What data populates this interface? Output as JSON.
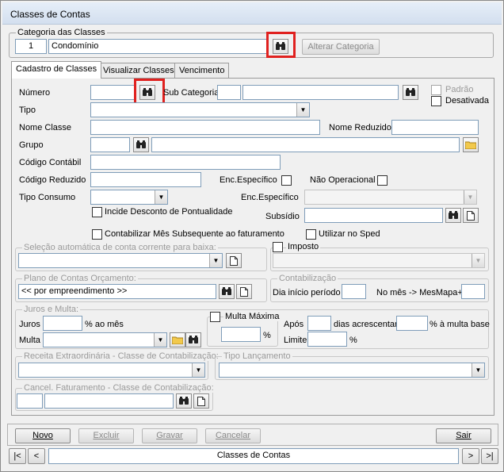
{
  "window": {
    "title": "Classes de Contas"
  },
  "categoria": {
    "caption": "Categoria das Classes",
    "code": "1",
    "name": "Condomínio",
    "alter_button": "Alterar Categoria"
  },
  "tabs": [
    {
      "label": "Cadastro de Classes",
      "active": true
    },
    {
      "label": "Visualizar Classes",
      "active": false
    },
    {
      "label": "Vencimento",
      "active": false
    }
  ],
  "form": {
    "numero_label": "Número",
    "numero_value": "",
    "subcategoria_label": "Sub Categoria",
    "padrao_label": "Padrão",
    "desativada_label": "Desativada",
    "tipo_label": "Tipo",
    "nome_classe_label": "Nome Classe",
    "nome_reduzido_label": "Nome Reduzido",
    "grupo_label": "Grupo",
    "codigo_contabil_label": "Código Contábil",
    "codigo_reduzido_label": "Código Reduzido",
    "enc_especifico_label": "Enc.Específico",
    "nao_operacional_label": "Não Operacional",
    "tipo_consumo_label": "Tipo Consumo",
    "enc_especifico2_label": "Enc.Específico",
    "incide_desconto_label": "Incide Desconto de Pontualidade",
    "subsidio_label": "Subsídio",
    "contabilizar_label": "Contabilizar Mês Subsequente ao faturamento",
    "utilizar_sped_label": "Utilizar no Sped"
  },
  "selecao": {
    "caption": "Seleção automática de conta corrente para baixa:"
  },
  "imposto": {
    "caption": "Imposto"
  },
  "plano": {
    "caption": "Plano de Contas Orçamento:",
    "value": "<< por empreendimento >>"
  },
  "contabilizacao": {
    "caption": "Contabilização",
    "dia_inicio_label": "Dia início período",
    "mes_label": "No mês -> MesMapa+"
  },
  "juros": {
    "caption": "Juros e Multa:",
    "juros_label": "Juros",
    "ao_mes_label": "% ao mês",
    "multa_label": "Multa",
    "multa_maxima_label": "Multa Máxima",
    "pct_label": "%",
    "apos_label": "Após",
    "dias_acrescentar_label": "dias acrescentar",
    "pct_multa_base_label": "% à multa base",
    "limite_label": "Limite",
    "limite_pct_label": "%"
  },
  "receita": {
    "caption": "Receita Extraordinária - Classe de Contabilização:"
  },
  "tipo_lancamento": {
    "caption": "Tipo Lançamento"
  },
  "cancel": {
    "caption": "Cancel. Faturamento - Classe de Contabilização:"
  },
  "actions": {
    "novo": "Novo",
    "excluir": "Excluir",
    "gravar": "Gravar",
    "cancelar": "Cancelar",
    "sair": "Sair"
  },
  "navigator": {
    "first": "|<",
    "prev": "<",
    "label": "Classes de Contas",
    "next": ">",
    "last": ">|"
  },
  "colors": {
    "highlight": "#e0211f",
    "window_bg": "#f0f0f0"
  }
}
